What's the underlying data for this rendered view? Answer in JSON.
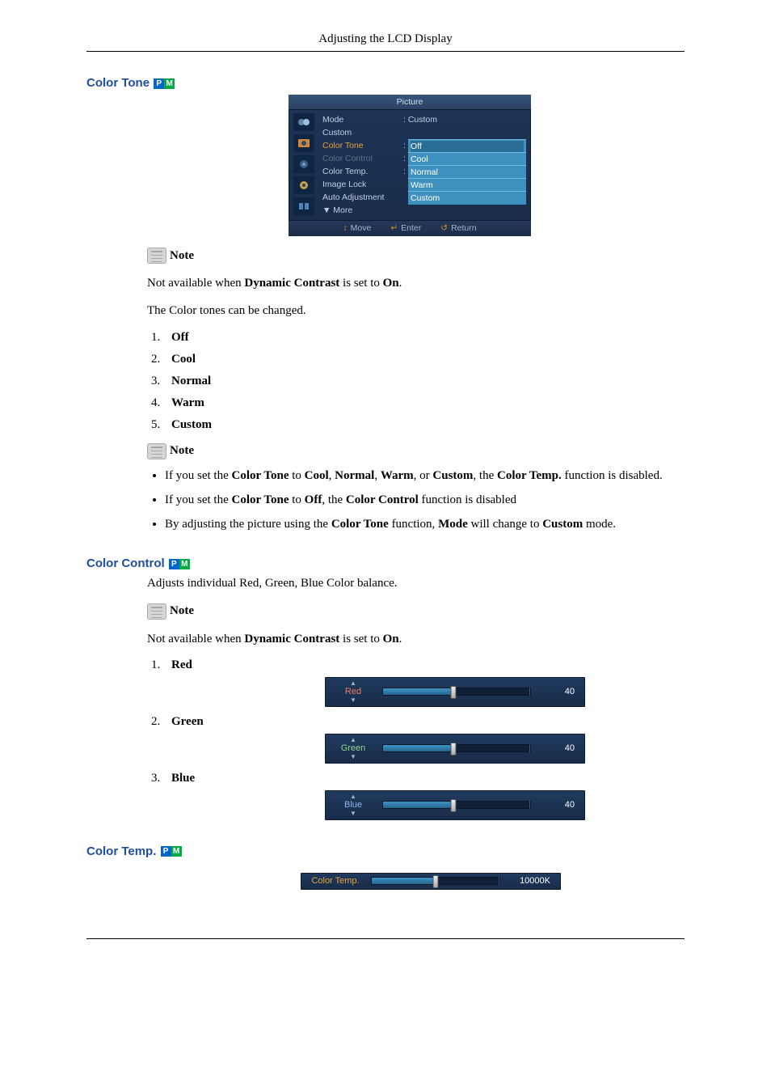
{
  "header": {
    "title": "Adjusting the LCD Display"
  },
  "sections": {
    "colorTone": {
      "heading": "Color Tone",
      "osd": {
        "title": "Picture",
        "rows": [
          {
            "label": "Mode",
            "value": ": Custom"
          },
          {
            "label": "Custom",
            "value": ""
          }
        ],
        "highlightLabel": "Color Tone",
        "disabledLabel": "Color Control",
        "dropdown": [
          "Off",
          "Cool",
          "Normal",
          "Warm",
          "Custom"
        ],
        "afterRows": [
          {
            "label": "Color Temp.",
            "value": ":"
          },
          {
            "label": "Image Lock",
            "value": ""
          },
          {
            "label": "Auto Adjustment",
            "value": ""
          },
          {
            "label": "▼ More",
            "value": ""
          }
        ],
        "footer": {
          "move": "Move",
          "enter": "Enter",
          "return": "Return"
        }
      },
      "noteLabel": "Note",
      "noteParas": [
        "Not available when Dynamic Contrast is set to On.",
        "The Color tones can be changed."
      ],
      "listItems": [
        "Off",
        "Cool",
        "Normal",
        "Warm",
        "Custom"
      ],
      "note2Label": "Note",
      "bullets": [
        "If you set the Color Tone to Cool, Normal, Warm, or Custom, the Color Temp. function is disabled.",
        "If you set the Color Tone to Off, the Color Control function is disabled",
        "By adjusting the picture using the Color Tone function, Mode will change to Custom mode."
      ]
    },
    "colorControl": {
      "heading": "Color Control",
      "intro": "Adjusts individual Red, Green, Blue Color balance.",
      "noteLabel": "Note",
      "notePara": "Not available when Dynamic Contrast is set to On.",
      "items": [
        {
          "label": "Red",
          "value": "40",
          "percent": 48
        },
        {
          "label": "Green",
          "value": "40",
          "percent": 48
        },
        {
          "label": "Blue",
          "value": "40",
          "percent": 48
        }
      ]
    },
    "colorTemp": {
      "heading": "Color Temp.",
      "slider": {
        "label": "Color Temp.",
        "value": "10000K",
        "percent": 50
      }
    }
  }
}
